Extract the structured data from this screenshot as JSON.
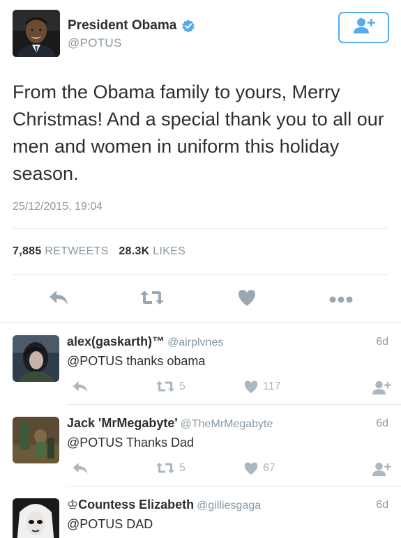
{
  "tweet": {
    "author_name": "President Obama",
    "author_handle": "@POTUS",
    "text": "From the Obama family to yours, Merry Christmas! And a special thank you to all our men and women in uniform this holiday season.",
    "timestamp": "25/12/2015, 19:04",
    "retweets_count": "7,885",
    "retweets_label": "RETWEETS",
    "likes_count": "28.3K",
    "likes_label": "LIKES"
  },
  "icons": {
    "verified": "verified-badge-icon",
    "follow": "follow-user-icon",
    "reply": "reply-icon",
    "retweet": "retweet-icon",
    "like": "heart-icon",
    "more": "more-dots-icon"
  },
  "colors": {
    "accent": "#55acee",
    "icon_gray": "#aab8c2",
    "text_secondary": "#8899a6",
    "divider": "#e1e8ed"
  },
  "replies": [
    {
      "name": "alex(gaskarth)™",
      "handle": "@airplvnes",
      "time": "6d",
      "text": "@POTUS thanks obama",
      "retweets": "5",
      "likes": "117"
    },
    {
      "name": "Jack 'MrMegabyte'",
      "handle": "@TheMrMegabyte",
      "time": "6d",
      "text": "@POTUS Thanks Dad",
      "retweets": "5",
      "likes": "67"
    },
    {
      "name": "♔Countess Elizabeth",
      "handle": "@gilliesgaga",
      "time": "6d",
      "text": "@POTUS DAD",
      "retweets": "",
      "likes": ""
    }
  ]
}
